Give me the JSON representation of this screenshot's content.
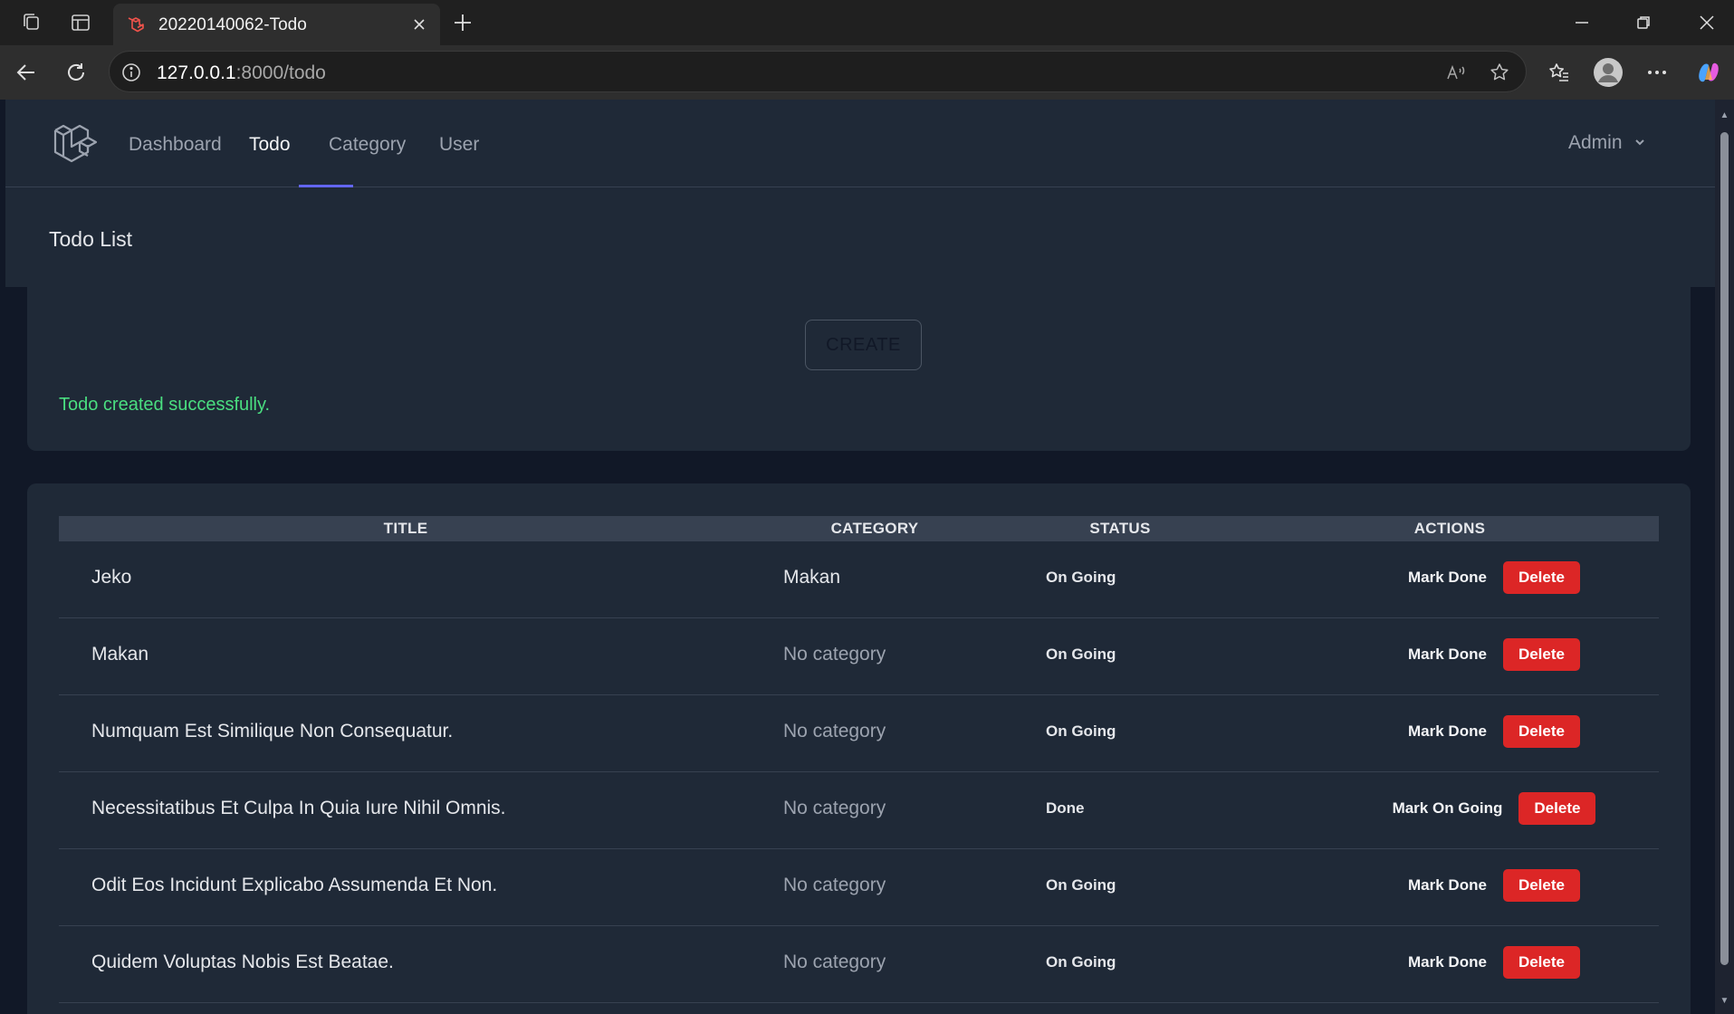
{
  "browser": {
    "tab_title": "20220140062-Todo",
    "url_host": "127.0.0.1",
    "url_path": ":8000/todo"
  },
  "nav": {
    "links": [
      "Dashboard",
      "Todo",
      "Category",
      "User"
    ],
    "active": "Todo",
    "user": "Admin"
  },
  "page": {
    "title": "Todo List",
    "create_label": "CREATE",
    "flash_message": "Todo created successfully."
  },
  "table": {
    "columns": [
      "TITLE",
      "CATEGORY",
      "STATUS",
      "ACTIONS"
    ],
    "rows": [
      {
        "title": "Jeko",
        "category": "Makan",
        "status": "On Going",
        "mark_label": "Mark Done",
        "delete_label": "Delete"
      },
      {
        "title": "Makan",
        "category": "No category",
        "status": "On Going",
        "mark_label": "Mark Done",
        "delete_label": "Delete"
      },
      {
        "title": "Numquam Est Similique Non Consequatur.",
        "category": "No category",
        "status": "On Going",
        "mark_label": "Mark Done",
        "delete_label": "Delete"
      },
      {
        "title": "Necessitatibus Et Culpa In Quia Iure Nihil Omnis.",
        "category": "No category",
        "status": "Done",
        "mark_label": "Mark On Going",
        "delete_label": "Delete"
      },
      {
        "title": "Odit Eos Incidunt Explicabo Assumenda Et Non.",
        "category": "No category",
        "status": "On Going",
        "mark_label": "Mark Done",
        "delete_label": "Delete"
      },
      {
        "title": "Quidem Voluptas Nobis Est Beatae.",
        "category": "No category",
        "status": "On Going",
        "mark_label": "Mark Done",
        "delete_label": "Delete"
      }
    ]
  },
  "colors": {
    "accent": "#6366f1",
    "success": "#4ade80",
    "danger": "#dc2626",
    "surface": "#1f2937",
    "background": "#111827"
  },
  "icons": {
    "logo": "laravel-logo-icon",
    "admin_dropdown": "chevron-down-icon"
  }
}
